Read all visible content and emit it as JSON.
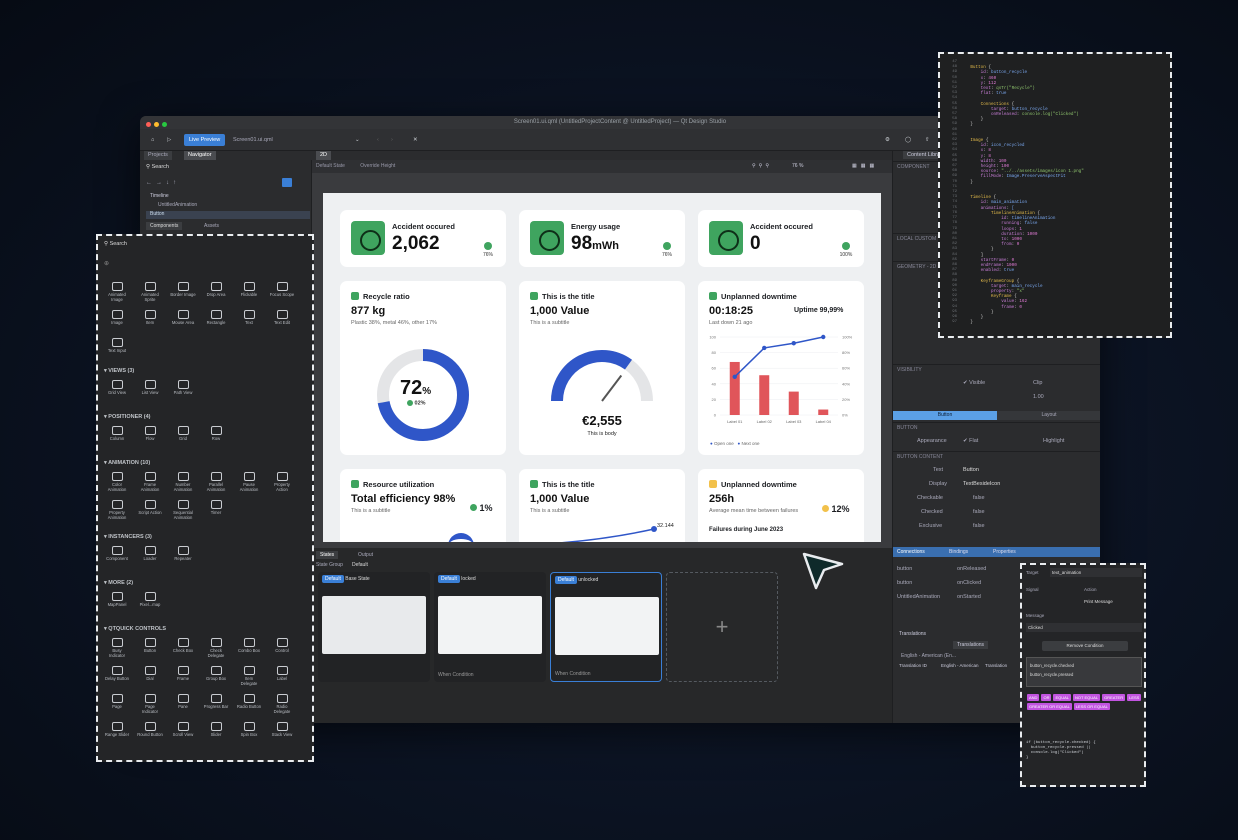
{
  "window": {
    "title": "Screen01.ui.qml (UntitledProjectContent @ UntitledProject) — Qt Design Studio",
    "toolbar": {
      "live_preview": "Live Preview",
      "file": "Screen01.ui.qml"
    },
    "left_tabs": [
      "Projects",
      "Navigator"
    ],
    "center_tab": "2D",
    "right_tab": "Content Libra...",
    "canvas_states": [
      "Default State",
      "Override Height"
    ],
    "zoom": "76 %"
  },
  "navigator": {
    "search": "Search",
    "tree": [
      "Timeline",
      "UntitledAnimation",
      "Button"
    ],
    "tabs": [
      "Components",
      "Assets"
    ]
  },
  "dashboard": {
    "top_cards": [
      {
        "title": "Accident occured",
        "value": "2,062",
        "unit": "",
        "pct": "76%"
      },
      {
        "title": "Energy usage",
        "value": "98",
        "unit": "mWh",
        "pct": "76%"
      },
      {
        "title": "Accident occured",
        "value": "0",
        "unit": "",
        "pct": "100%"
      }
    ],
    "recycle": {
      "title": "Recycle ratio",
      "value": "877 kg",
      "subtitle": "Plastic 38%, metal 46%, other 17%",
      "gauge_value": "72",
      "gauge_unit": "%",
      "gauge_sub": "02%",
      "fraction": 0.72
    },
    "value_card": {
      "title": "This is the title",
      "value": "1,000 Value",
      "subtitle": "This is a subtitle",
      "amount": "€2,555",
      "body": "This is body",
      "fraction": 0.7
    },
    "downtime": {
      "title": "Unplanned downtime",
      "value": "00:18:25",
      "uptime": "Uptime 99,99%",
      "subtitle": "Last down 21 ago",
      "legend": [
        "Open one",
        "Next one"
      ]
    },
    "resource": {
      "title": "Resource utilization",
      "value": "Total efficiency 98%",
      "subtitle": "This is a subtitle",
      "pct": "1%"
    },
    "value_card2": {
      "title": "This is the title",
      "value": "1,000 Value",
      "subtitle": "This is a subtitle",
      "last": "32.144"
    },
    "downtime2": {
      "title": "Unplanned downtime",
      "value": "256h",
      "subtitle": "Average mean time between failures",
      "pct": "12%",
      "footer": "Failures during June 2023"
    }
  },
  "chart_data": {
    "type": "bar",
    "categories": [
      "Label 01",
      "Label 02",
      "Label 03",
      "Label 04"
    ],
    "series": [
      {
        "name": "Open one",
        "type": "bar",
        "values": [
          68,
          51,
          30,
          7
        ]
      },
      {
        "name": "Next one",
        "type": "line",
        "values": [
          49,
          86,
          92,
          100
        ]
      }
    ],
    "ylim_left": [
      0,
      100
    ],
    "ylim_right": [
      0,
      100
    ],
    "yticks_left": [
      "100",
      "80",
      "60",
      "40",
      "20",
      "0"
    ],
    "yticks_right": [
      "100%",
      "80%",
      "60%",
      "40%",
      "20%",
      "0%"
    ],
    "colors": {
      "bar": "#e0555a",
      "line": "#2f56c8"
    }
  },
  "bottom": {
    "tabs": [
      "States",
      "Output"
    ],
    "group_label": "State Group",
    "group_value": "Default",
    "states": [
      {
        "badge": "Default",
        "name": "Base State",
        "caption": ""
      },
      {
        "badge": "Default",
        "name": "locked",
        "caption": "When Condition"
      },
      {
        "badge": "Default",
        "name": "unlocked",
        "caption": "When Condition"
      }
    ],
    "add": "+"
  },
  "properties": {
    "sections": [
      "COMPONENT",
      "LOCAL CUSTOM",
      "GEOMETRY - 2D",
      "VISIBILITY",
      "BUTTON",
      "BUTTON CONTENT"
    ],
    "visible": "Visible",
    "clip": "Clip",
    "opacity_value": "1.00",
    "subtabs": [
      "Button",
      "Layout"
    ],
    "appearance": "Appearance",
    "flat": "Flat",
    "highlight": "Highlight",
    "text_label": "Text",
    "text_value": "Button",
    "display_label": "Display",
    "display_value": "TextBesideIcon",
    "checkable": "Checkable",
    "checked": "Checked",
    "exclusive": "Exclusive",
    "false_val": "false",
    "connections_tabs": [
      "Connections",
      "Bindings",
      "Properties"
    ],
    "connections": [
      {
        "target": "button",
        "signal": "onReleased"
      },
      {
        "target": "button",
        "signal": "onClicked"
      },
      {
        "target": "UntitledAnimation",
        "signal": "onStarted"
      }
    ],
    "translations": "Translations",
    "translation_cols": [
      "Translation ID",
      "English - American",
      "Translation"
    ],
    "language": "English - American (En..."
  },
  "components_panel": {
    "search": "Search",
    "basic": [
      "Animated Image",
      "Animated Sprite",
      "Border Image",
      "Drop Area",
      "Flickable",
      "Focus Scope",
      "Image",
      "Item",
      "Mouse Area",
      "Rectangle",
      "Text",
      "Text Edit",
      "Text Input"
    ],
    "sections": [
      {
        "title": "VIEWS (3)",
        "items": [
          "Grid View",
          "List View",
          "Path View"
        ]
      },
      {
        "title": "POSITIONER (4)",
        "items": [
          "Column",
          "Flow",
          "Grid",
          "Row"
        ]
      },
      {
        "title": "ANIMATION (10)",
        "items": [
          "Color Animation",
          "Frame Animation",
          "Number Animation",
          "Parallel Animation",
          "Pause Animation",
          "Property Action",
          "Property Animation",
          "Script Action",
          "Sequential Animation",
          "Timer"
        ]
      },
      {
        "title": "INSTANCERS (3)",
        "items": [
          "Component",
          "Loader",
          "Repeater"
        ]
      },
      {
        "title": "MORE (2)",
        "items": [
          "MapPanel",
          "Pixel...map"
        ]
      }
    ],
    "qtquick_title": "QTQUICK CONTROLS",
    "qtquick": [
      "Busy Indicator",
      "Button",
      "Check Box",
      "Check Delegate",
      "Combo Box",
      "Control",
      "Delay Button",
      "Dial",
      "Frame",
      "Group Box",
      "Item Delegate",
      "Label",
      "Page",
      "Page Indicator",
      "Pane",
      "Progress Bar",
      "Radio Button",
      "Radio Delegate",
      "Range Slider",
      "Round Button",
      "Scroll View",
      "Slider",
      "Spin Box",
      "Stack View"
    ]
  },
  "code_panel": {
    "start_line": 47,
    "lines": [
      "",
      "    Button {",
      "        id: button_recycle",
      "        x: 460",
      "        y: 112",
      "        text: qsTr(\"Recycle\")",
      "        flat: true",
      "",
      "        Connections {",
      "            target: button_recycle",
      "            onReleased: console.log(\"Clicked\")",
      "        }",
      "    }",
      "",
      "",
      "    Image {",
      "        id: icon_recycled",
      "        x: 8",
      "        y: 8",
      "        width: 100",
      "        height: 100",
      "        source: \"../../assets/images/icon 1.png\"",
      "        fillMode: Image.PreserveAspectFit",
      "    }",
      "",
      "",
      "    Timeline {",
      "        id: main_animation",
      "        animations: [",
      "            TimelineAnimation {",
      "                id: timelineAnimation",
      "                running: false",
      "                loops: 1",
      "                duration: 1000",
      "                to: 1000",
      "                from: 0",
      "            }",
      "        ]",
      "        startFrame: 0",
      "        endFrame: 1000",
      "        enabled: true",
      "",
      "        KeyframeGroup {",
      "            target: main_recycle",
      "            property: \"x\"",
      "            Keyframe {",
      "                value: 162",
      "                frame: 0",
      "            }",
      "        }",
      "    }"
    ]
  },
  "connection_panel": {
    "target_label": "Target",
    "target_value": "text_animation",
    "signal_label": "Signal",
    "action_label": "Action",
    "action_value": "Print Message",
    "message_label": "Message",
    "message_value": "Clicked",
    "remove_condition": "Remove Condition",
    "cond_lines": [
      "button_recycle.checked",
      "button_recycle.pressed"
    ],
    "operators": [
      "AND",
      "OR",
      "EQUAL",
      "NOT EQUAL",
      "GREATER",
      "LESS",
      "GREATER OR EQUAL",
      "LESS OR EQUAL"
    ],
    "code": [
      "if (button_recycle.checked) {",
      "  button_recycle.pressed ||",
      "  console.log(\"Clicked\")",
      "}"
    ]
  }
}
